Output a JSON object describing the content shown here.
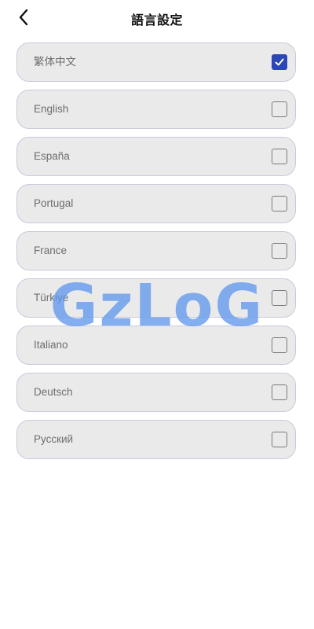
{
  "header": {
    "title": "語言設定",
    "back_icon": "chevron-left-icon"
  },
  "languages": [
    {
      "label": "繁体中文",
      "checked": true
    },
    {
      "label": "English",
      "checked": false
    },
    {
      "label": "España",
      "checked": false
    },
    {
      "label": "Portugal",
      "checked": false
    },
    {
      "label": "France",
      "checked": false
    },
    {
      "label": "Türkiye",
      "checked": false
    },
    {
      "label": "Italiano",
      "checked": false
    },
    {
      "label": "Deutsch",
      "checked": false
    },
    {
      "label": "Русский",
      "checked": false
    }
  ],
  "watermark": {
    "text": "GzLoG"
  },
  "colors": {
    "checkbox_checked": "#2b46b5",
    "item_background": "#ebeaeb",
    "item_border": "#c9c9dc",
    "watermark": "#6098ec"
  }
}
